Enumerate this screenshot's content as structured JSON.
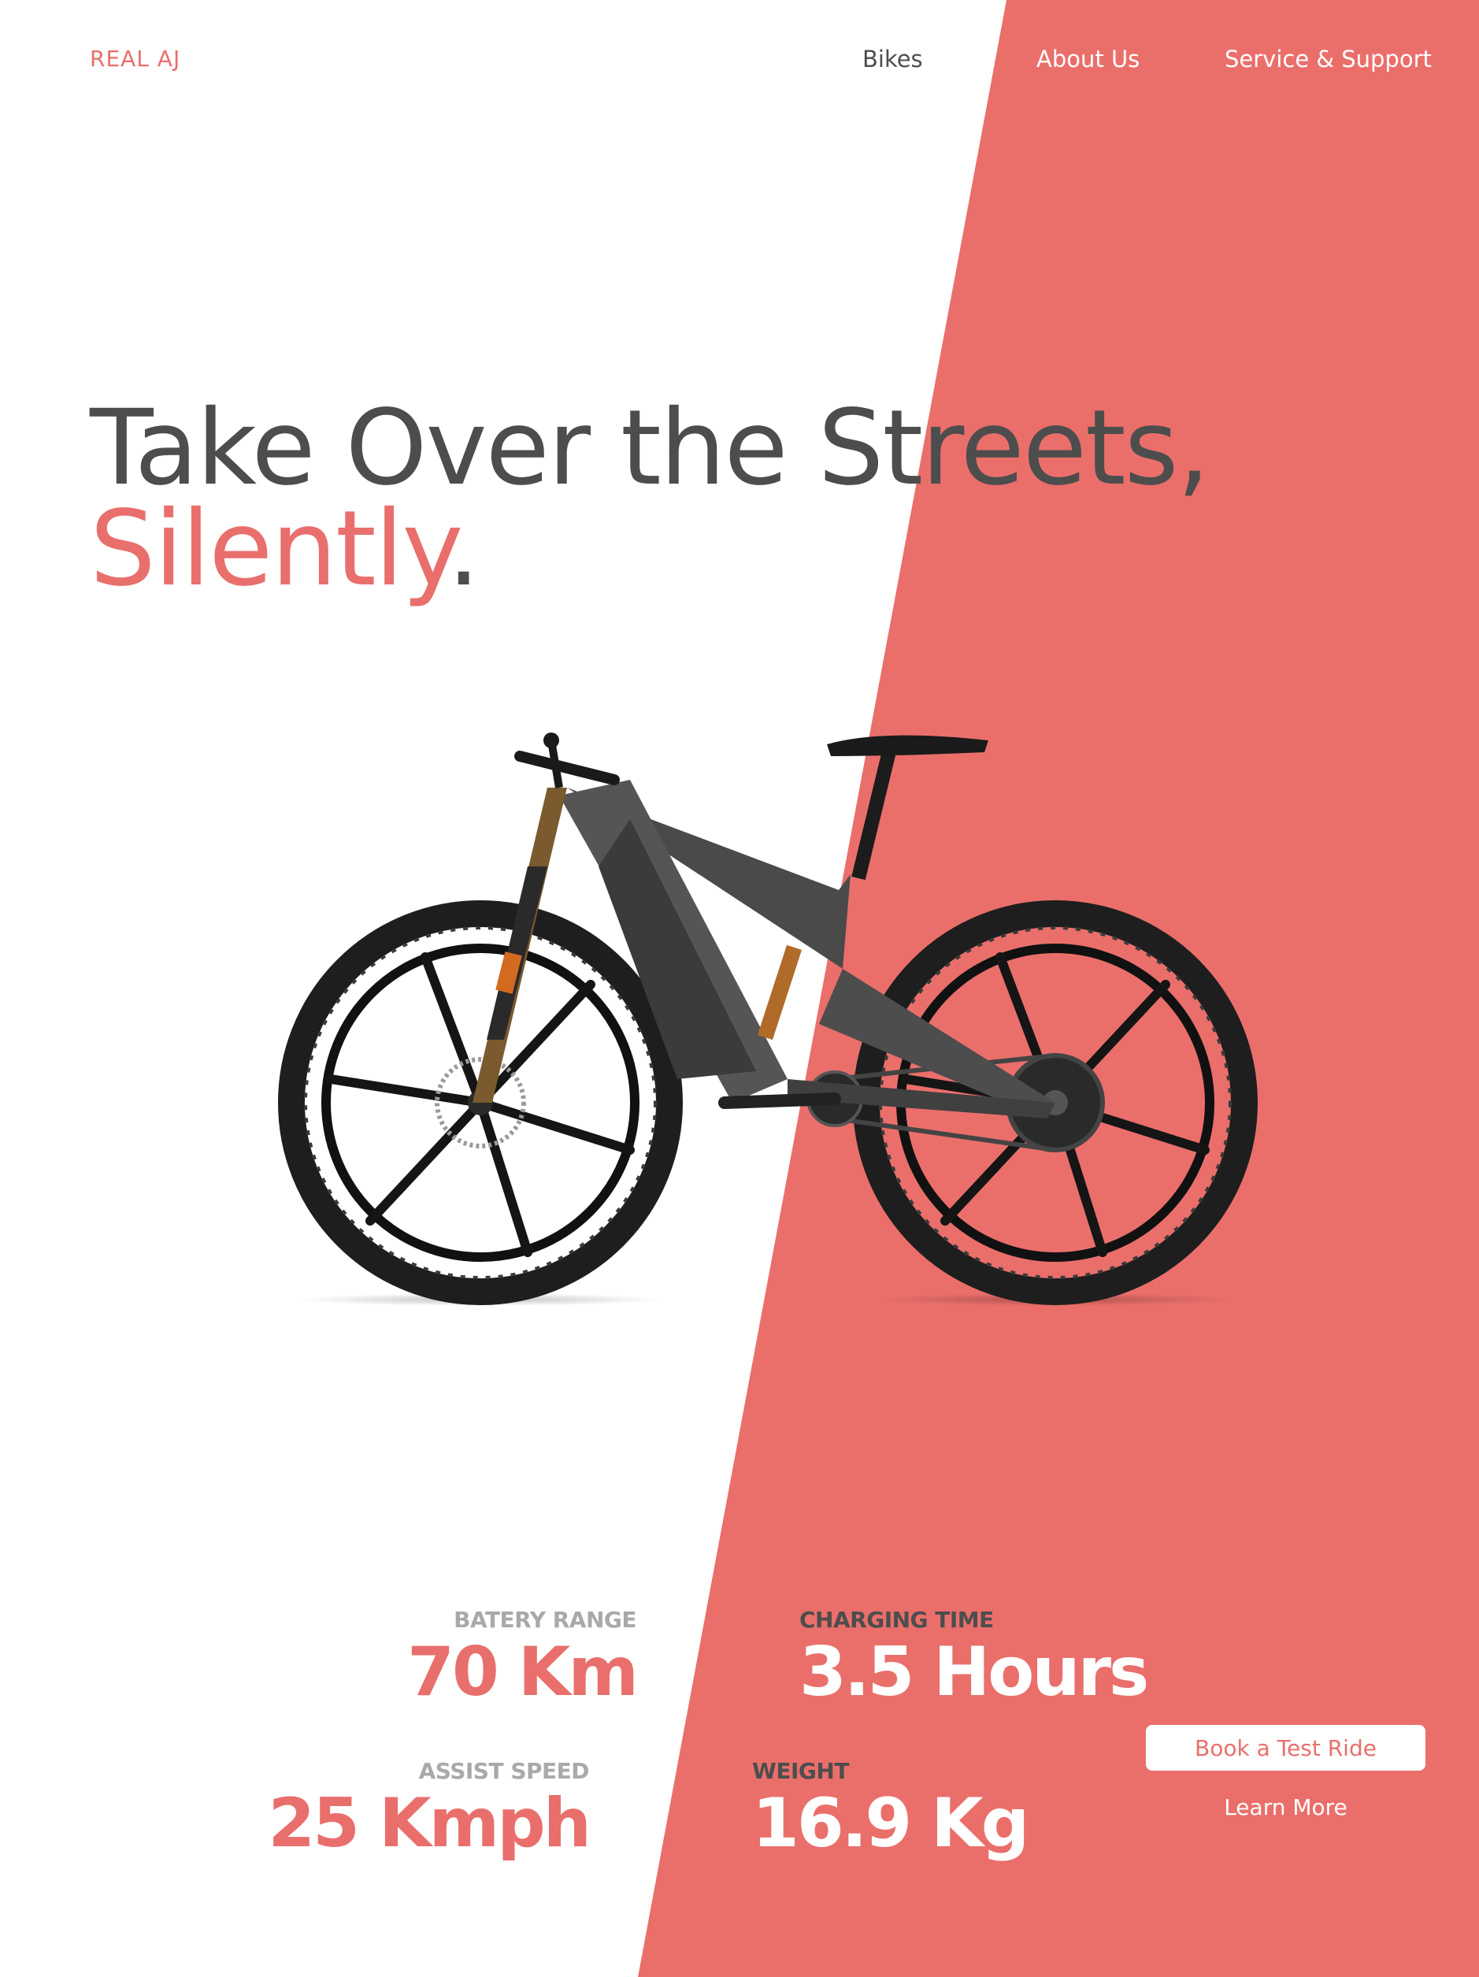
{
  "nav": {
    "logo": "REAL AJ",
    "links": [
      "Bikes",
      "About Us",
      "Service & Support"
    ]
  },
  "hero": {
    "headline_line1": "Take Over the Streets,",
    "headline_accent": "Silently",
    "headline_dot": "."
  },
  "stats": {
    "range": {
      "label": "BATERY RANGE",
      "value": "70 Km"
    },
    "charge": {
      "label": "CHARGING TIME",
      "value": "3.5 Hours"
    },
    "speed": {
      "label": "ASSIST SPEED",
      "value": "25 Kmph"
    },
    "weight": {
      "label": "WEIGHT",
      "value": "16.9 Kg"
    }
  },
  "cta": {
    "book": "Book a Test Ride",
    "learn": "Learn More"
  },
  "colors": {
    "accent": "#e96f6c",
    "text_dark": "#4d4d4d",
    "label_gray": "#a9a9a9",
    "background": "#ffffff"
  },
  "icons": {
    "hero_image": "e-mountain-bike"
  }
}
